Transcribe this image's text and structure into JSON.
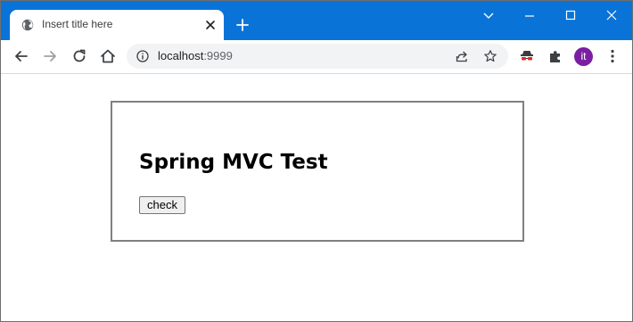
{
  "browser": {
    "tab": {
      "title": "Insert title here",
      "favicon": "globe-icon"
    },
    "address_bar": {
      "host": "localhost",
      "port": ":9999"
    },
    "profile_initials": "it",
    "colors": {
      "titlebar": "#0a73d8",
      "avatar": "#7b1fa2"
    }
  },
  "page": {
    "heading": "Spring MVC Test",
    "check_button_label": "check"
  }
}
